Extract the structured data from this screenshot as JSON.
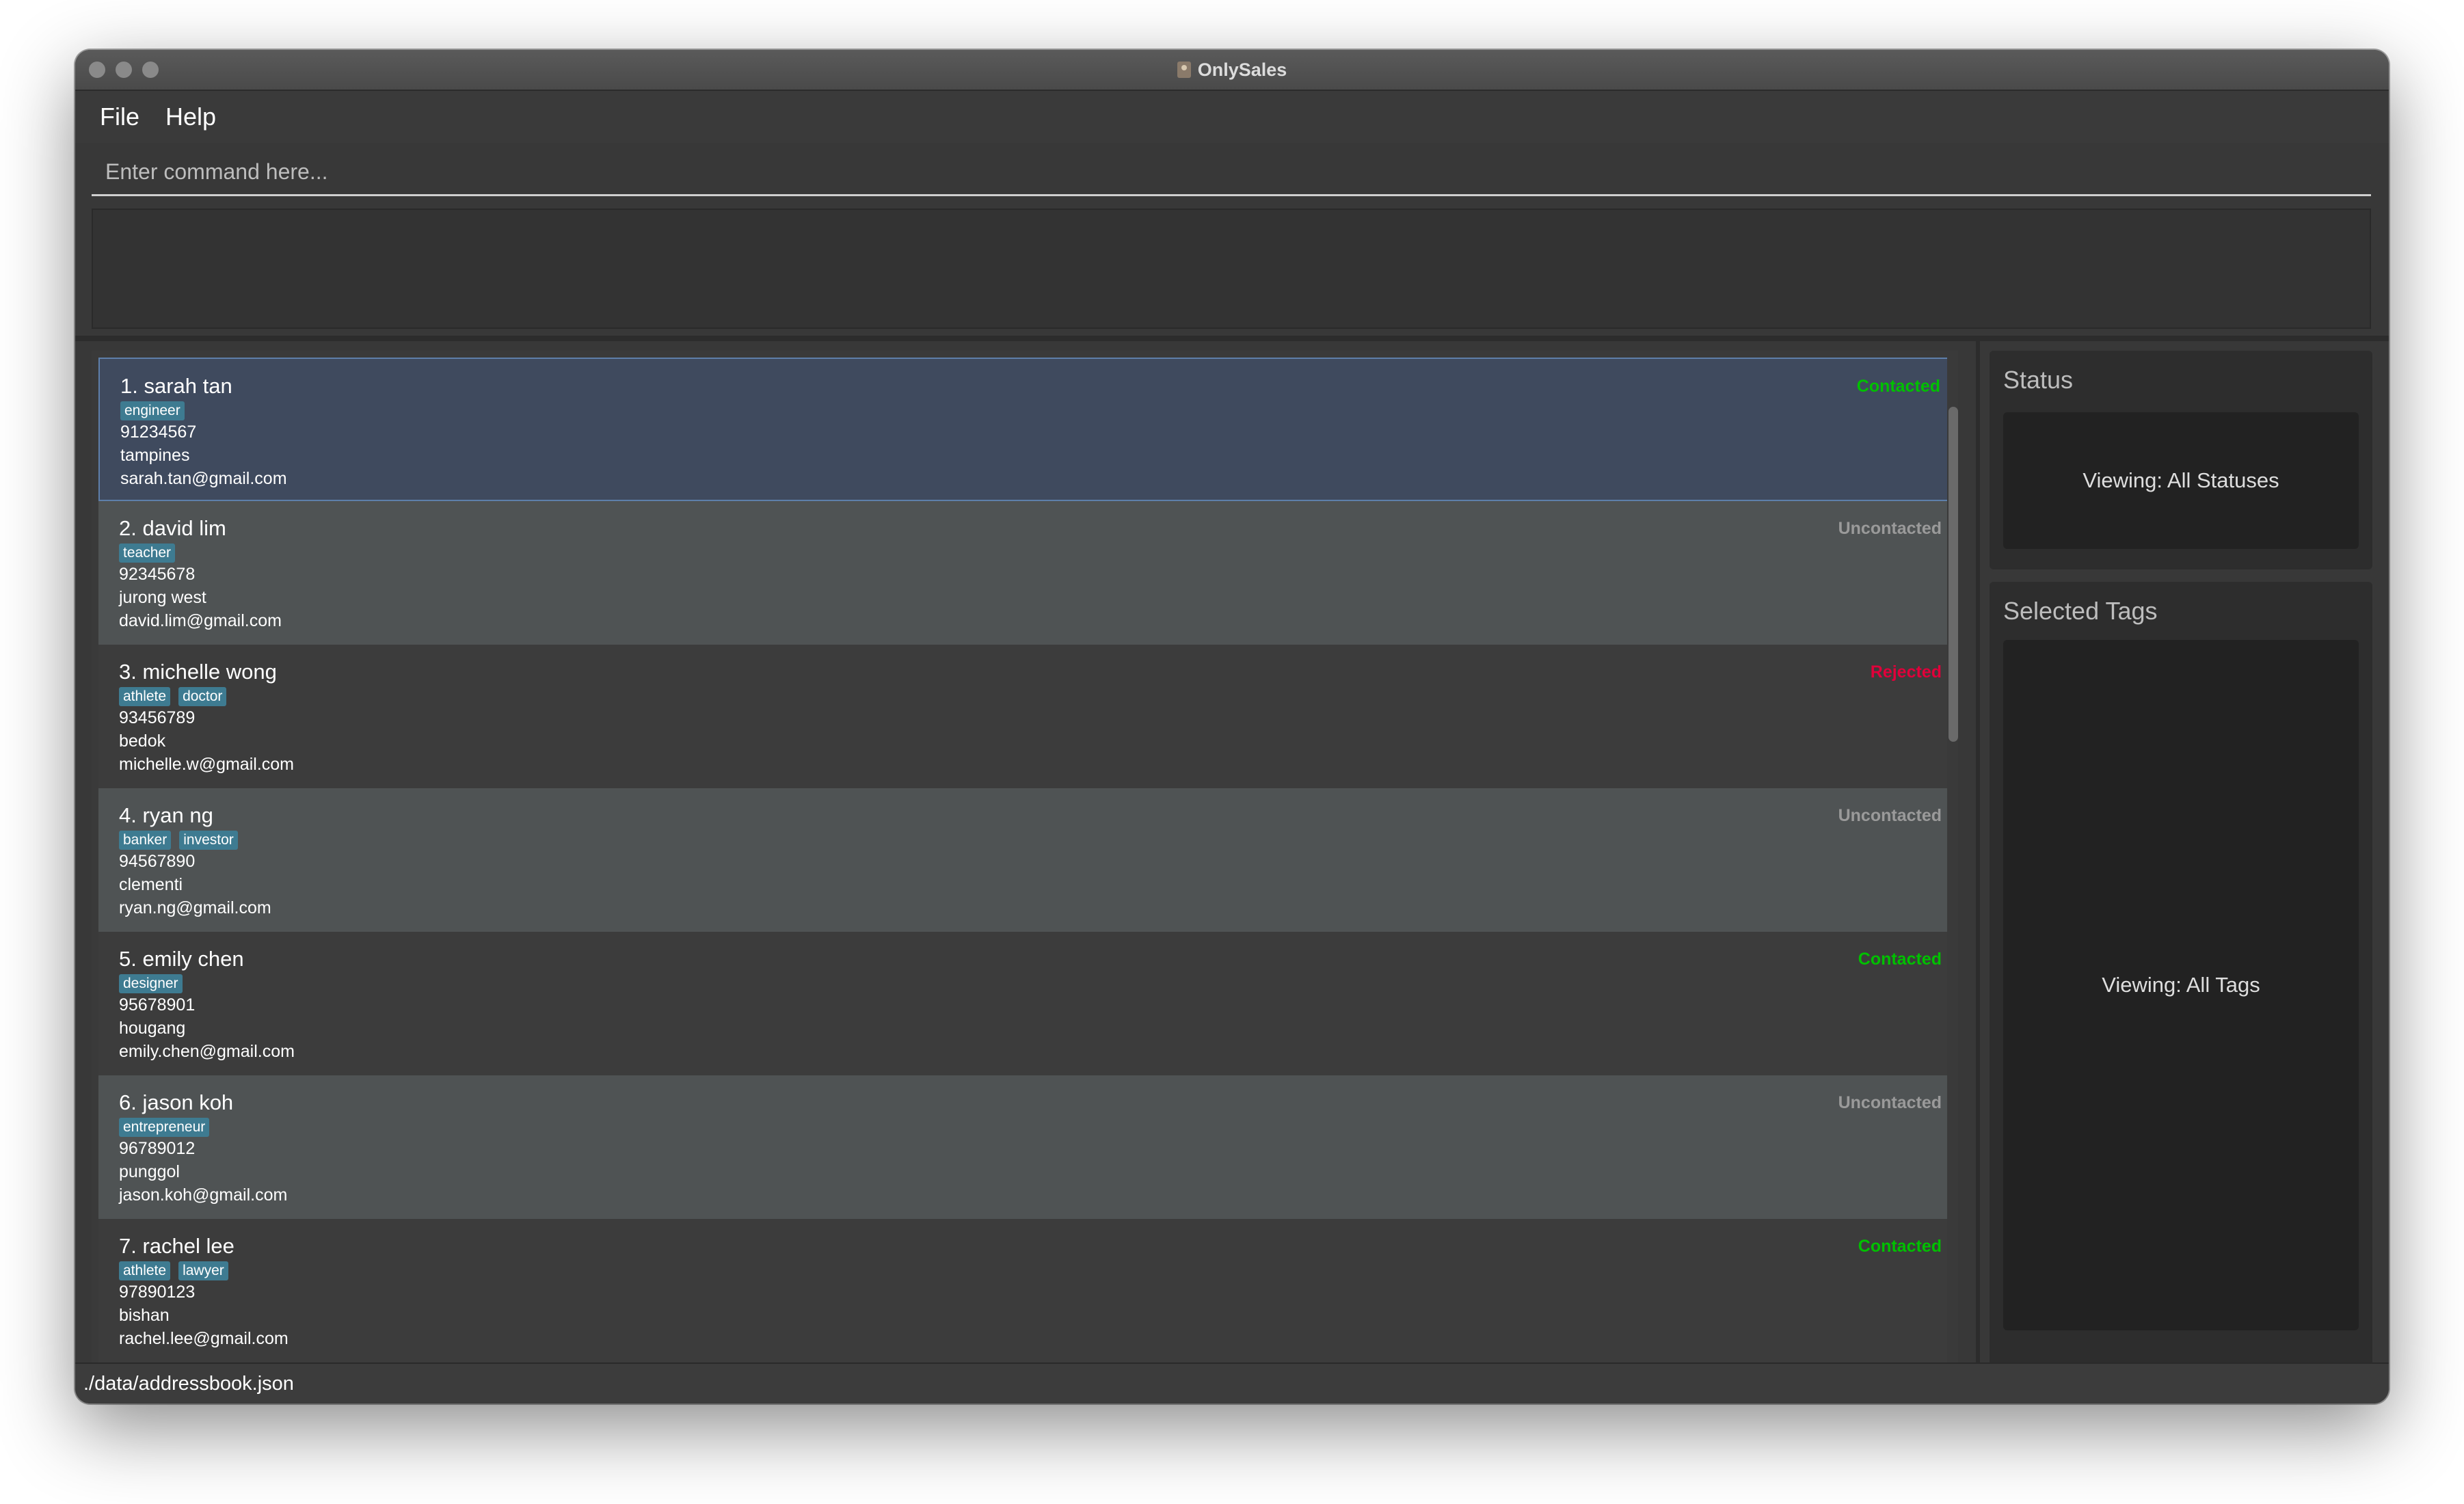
{
  "window": {
    "title": "OnlySales"
  },
  "menu": {
    "file": "File",
    "help": "Help"
  },
  "command": {
    "placeholder": "Enter command here...",
    "value": ""
  },
  "result": {
    "text": ""
  },
  "persons": [
    {
      "name": "1. sarah tan",
      "tags": [
        "engineer"
      ],
      "phone": "91234567",
      "address": "tampines",
      "email": "sarah.tan@gmail.com",
      "status": "Contacted",
      "status_color": "#00c000"
    },
    {
      "name": "2. david lim",
      "tags": [
        "teacher"
      ],
      "phone": "92345678",
      "address": "jurong west",
      "email": "david.lim@gmail.com",
      "status": "Uncontacted",
      "status_color": "#9a9a9a"
    },
    {
      "name": "3. michelle wong",
      "tags": [
        "athlete",
        "doctor"
      ],
      "phone": "93456789",
      "address": "bedok",
      "email": "michelle.w@gmail.com",
      "status": "Rejected",
      "status_color": "#e0003a"
    },
    {
      "name": "4. ryan ng",
      "tags": [
        "banker",
        "investor"
      ],
      "phone": "94567890",
      "address": "clementi",
      "email": "ryan.ng@gmail.com",
      "status": "Uncontacted",
      "status_color": "#9a9a9a"
    },
    {
      "name": "5. emily chen",
      "tags": [
        "designer"
      ],
      "phone": "95678901",
      "address": "hougang",
      "email": "emily.chen@gmail.com",
      "status": "Contacted",
      "status_color": "#00c000"
    },
    {
      "name": "6. jason koh",
      "tags": [
        "entrepreneur"
      ],
      "phone": "96789012",
      "address": "punggol",
      "email": "jason.koh@gmail.com",
      "status": "Uncontacted",
      "status_color": "#9a9a9a"
    },
    {
      "name": "7. rachel lee",
      "tags": [
        "athlete",
        "lawyer"
      ],
      "phone": "97890123",
      "address": "bishan",
      "email": "rachel.lee@gmail.com",
      "status": "Contacted",
      "status_color": "#00c000"
    }
  ],
  "sidebar": {
    "status_title": "Status",
    "status_value": "Viewing: All Statuses",
    "tags_title": "Selected Tags",
    "tags_value": "Viewing: All Tags"
  },
  "statusbar": {
    "path": "./data/addressbook.json"
  }
}
